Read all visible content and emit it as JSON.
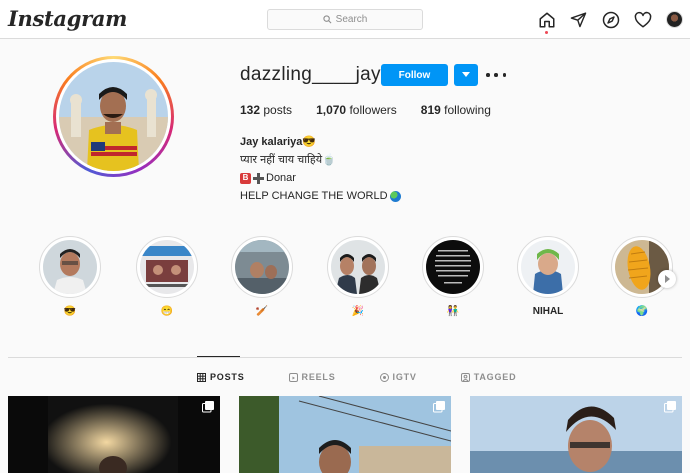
{
  "app": {
    "logo": "Instagram"
  },
  "search": {
    "placeholder": "Search"
  },
  "nav": {
    "icons": [
      "home-icon",
      "direct-icon",
      "explore-icon",
      "activity-icon",
      "profile-avatar"
    ]
  },
  "profile": {
    "username": "dazzling____jay",
    "follow_label": "Follow",
    "stats": {
      "posts_count": "132",
      "posts_label": "posts",
      "followers_count": "1,070",
      "followers_label": "followers",
      "following_count": "819",
      "following_label": "following"
    },
    "bio": {
      "name": "Jay kalariya",
      "name_emoji": "😎",
      "line1": "प्यार नहीं चाय चाहिये",
      "line1_emoji": "🍵",
      "line2": "Donar",
      "line3": "HELP CHANGE THE WORLD"
    }
  },
  "highlights": [
    {
      "label": "😎"
    },
    {
      "label": "😁"
    },
    {
      "label": "🏏"
    },
    {
      "label": "🎉"
    },
    {
      "label": "👫"
    },
    {
      "label": "NIHAL"
    },
    {
      "label": "🌍"
    }
  ],
  "tabs": [
    {
      "label": "POSTS",
      "active": true
    },
    {
      "label": "REELS",
      "active": false
    },
    {
      "label": "IGTV",
      "active": false
    },
    {
      "label": "TAGGED",
      "active": false
    }
  ],
  "colors": {
    "accent": "#0095f6",
    "text": "#262626",
    "muted": "#8e8e8e",
    "border": "#dbdbdb",
    "notification": "#ed4956"
  }
}
